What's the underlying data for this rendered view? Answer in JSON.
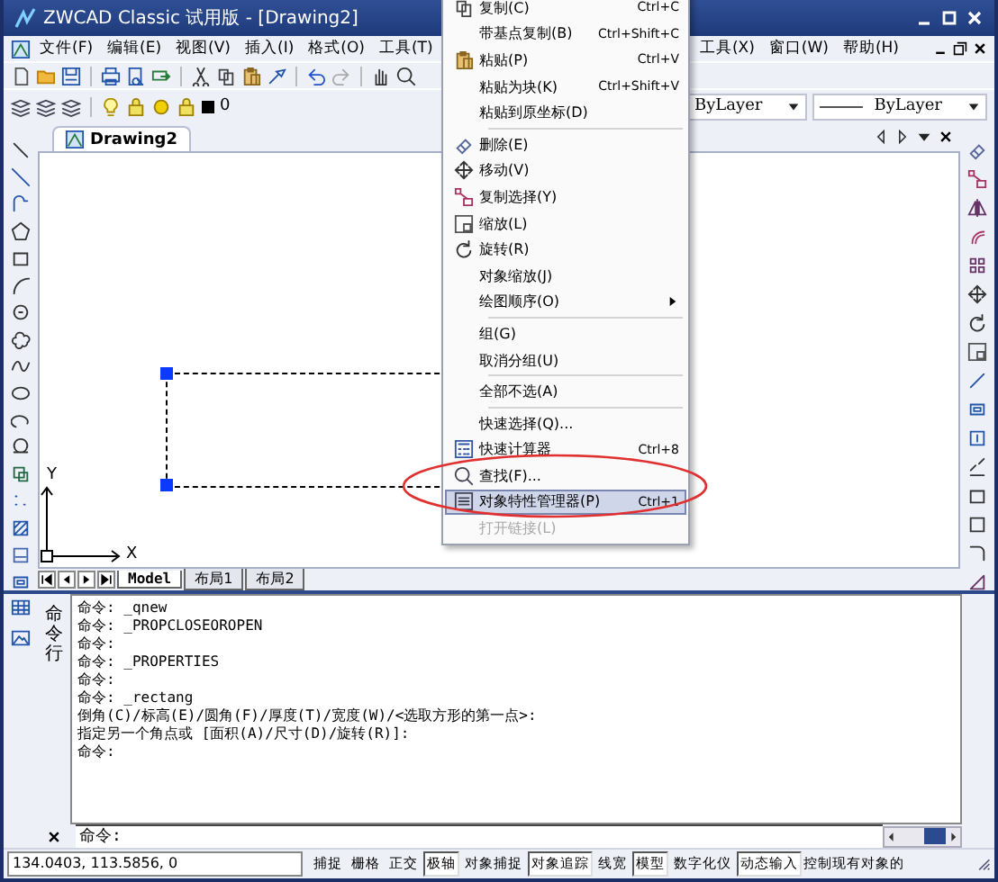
{
  "window": {
    "title": "ZWCAD Classic 试用版 - [Drawing2]"
  },
  "menu_bar": {
    "items": [
      "文件(F)",
      "编辑(E)",
      "视图(V)",
      "插入(I)",
      "格式(O)",
      "工具(T)"
    ],
    "right_items": [
      "工具(X)",
      "窗口(W)",
      "帮助(H)"
    ]
  },
  "property_bar": {
    "layer": "0",
    "linetype": "ByLayer",
    "lineweight": "ByLayer"
  },
  "document_tab": {
    "title": "Drawing2"
  },
  "ucs": {
    "x_label": "X",
    "y_label": "Y"
  },
  "layout_tabs": [
    {
      "label": "Model",
      "selected": true
    },
    {
      "label": "布局1",
      "selected": false
    },
    {
      "label": "布局2",
      "selected": false
    }
  ],
  "command_panel": {
    "side_label": "命令行",
    "history": [
      "命令: _qnew",
      "命令: _PROPCLOSEOROPEN",
      "命令:",
      "命令: _PROPERTIES",
      "命令:",
      "命令: _rectang",
      "倒角(C)/标高(E)/圆角(F)/厚度(T)/宽度(W)/<选取方形的第一点>:",
      "指定另一个角点或 [面积(A)/尺寸(D)/旋转(R)]:",
      "命令:"
    ],
    "prompt": "命令:"
  },
  "status_bar": {
    "coordinates": "134.0403,  113.5856,  0",
    "toggles": [
      {
        "label": "捕捉",
        "on": false
      },
      {
        "label": "栅格",
        "on": false
      },
      {
        "label": "正交",
        "on": false
      },
      {
        "label": "极轴",
        "on": true
      },
      {
        "label": "对象捕捉",
        "on": false
      },
      {
        "label": "对象追踪",
        "on": true
      },
      {
        "label": "线宽",
        "on": false
      },
      {
        "label": "模型",
        "on": true
      },
      {
        "label": "数字化仪",
        "on": false
      },
      {
        "label": "动态输入",
        "on": true
      }
    ],
    "message": "控制现有对象的"
  },
  "context_menu": {
    "items": [
      {
        "kind": "item",
        "label": "复制(C)",
        "shortcut": "Ctrl+C",
        "selected": false,
        "disabled": false,
        "submenu": false
      },
      {
        "kind": "item",
        "label": "带基点复制(B)",
        "shortcut": "Ctrl+Shift+C",
        "selected": false,
        "disabled": false,
        "submenu": false
      },
      {
        "kind": "item",
        "label": "粘贴(P)",
        "shortcut": "Ctrl+V",
        "selected": false,
        "disabled": false,
        "submenu": false
      },
      {
        "kind": "item",
        "label": "粘贴为块(K)",
        "shortcut": "Ctrl+Shift+V",
        "selected": false,
        "disabled": false,
        "submenu": false
      },
      {
        "kind": "item",
        "label": "粘贴到原坐标(D)",
        "selected": false,
        "disabled": false,
        "submenu": false
      },
      {
        "kind": "separator"
      },
      {
        "kind": "item",
        "label": "删除(E)",
        "selected": false,
        "disabled": false,
        "submenu": false
      },
      {
        "kind": "item",
        "label": "移动(V)",
        "selected": false,
        "disabled": false,
        "submenu": false
      },
      {
        "kind": "item",
        "label": "复制选择(Y)",
        "selected": false,
        "disabled": false,
        "submenu": false
      },
      {
        "kind": "item",
        "label": "缩放(L)",
        "selected": false,
        "disabled": false,
        "submenu": false
      },
      {
        "kind": "item",
        "label": "旋转(R)",
        "selected": false,
        "disabled": false,
        "submenu": false
      },
      {
        "kind": "item",
        "label": "对象缩放(J)",
        "selected": false,
        "disabled": false,
        "submenu": false
      },
      {
        "kind": "item",
        "label": "绘图顺序(O)",
        "selected": false,
        "disabled": false,
        "submenu": true
      },
      {
        "kind": "separator"
      },
      {
        "kind": "item",
        "label": "组(G)",
        "selected": false,
        "disabled": false,
        "submenu": false
      },
      {
        "kind": "item",
        "label": "取消分组(U)",
        "selected": false,
        "disabled": false,
        "submenu": false
      },
      {
        "kind": "separator"
      },
      {
        "kind": "item",
        "label": "全部不选(A)",
        "selected": false,
        "disabled": false,
        "submenu": false
      },
      {
        "kind": "separator"
      },
      {
        "kind": "item",
        "label": "快速选择(Q)...",
        "selected": false,
        "disabled": false,
        "submenu": false
      },
      {
        "kind": "item",
        "label": "快速计算器",
        "shortcut": "Ctrl+8",
        "selected": false,
        "disabled": false,
        "submenu": false
      },
      {
        "kind": "item",
        "label": "查找(F)...",
        "selected": false,
        "disabled": false,
        "submenu": false
      },
      {
        "kind": "item",
        "label": "对象特性管理器(P)",
        "shortcut": "Ctrl+1",
        "selected": true,
        "disabled": false,
        "submenu": false
      },
      {
        "kind": "item",
        "label": "打开链接(L)",
        "selected": false,
        "disabled": true,
        "submenu": false
      }
    ]
  }
}
